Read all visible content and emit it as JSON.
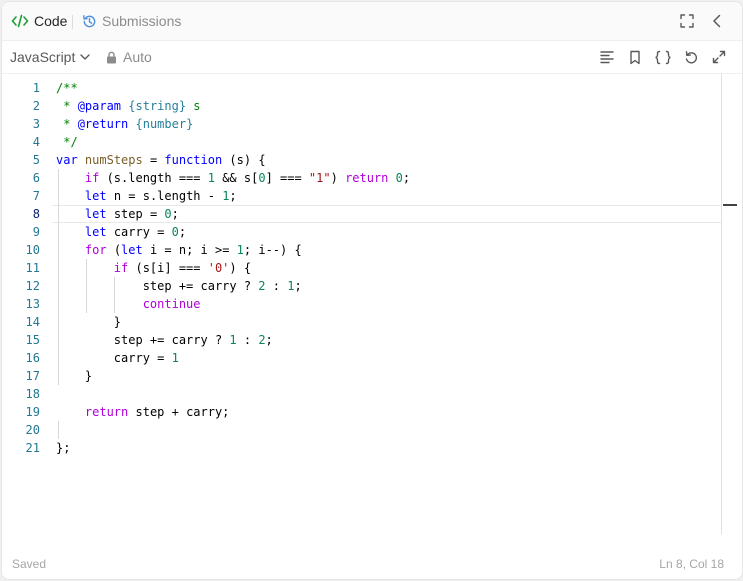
{
  "tabs": {
    "code_label": "Code",
    "submissions_label": "Submissions"
  },
  "toolbar": {
    "language": "JavaScript",
    "mode": "Auto"
  },
  "editor": {
    "line_numbers": [
      "1",
      "2",
      "3",
      "4",
      "5",
      "6",
      "7",
      "8",
      "9",
      "10",
      "11",
      "12",
      "13",
      "14",
      "15",
      "16",
      "17",
      "18",
      "19",
      "20",
      "21"
    ],
    "current_line": 8,
    "code": [
      "/**",
      " * @param {string} s",
      " * @return {number}",
      " */",
      "var numSteps = function (s) {",
      "    if (s.length === 1 && s[0] === \"1\") return 0;",
      "    let n = s.length - 1;",
      "    let step = 0;",
      "    let carry = 0;",
      "    for (let i = n; i >= 1; i--) {",
      "        if (s[i] === '0') {",
      "            step += carry ? 2 : 1;",
      "            continue",
      "        }",
      "        step += carry ? 1 : 2;",
      "        carry = 1",
      "    }",
      "",
      "    return step + carry;",
      "",
      "};"
    ]
  },
  "status": {
    "saved": "Saved",
    "position": "Ln 8, Col 18"
  },
  "colors": {
    "keyword": "#0000ff",
    "control": "#af00db",
    "function": "#795e26",
    "number": "#098658",
    "string": "#a31515",
    "comment": "#008000",
    "line_number": "#237893",
    "code_icon": "#1f9e3a",
    "submissions_icon": "#4b8fdc"
  }
}
